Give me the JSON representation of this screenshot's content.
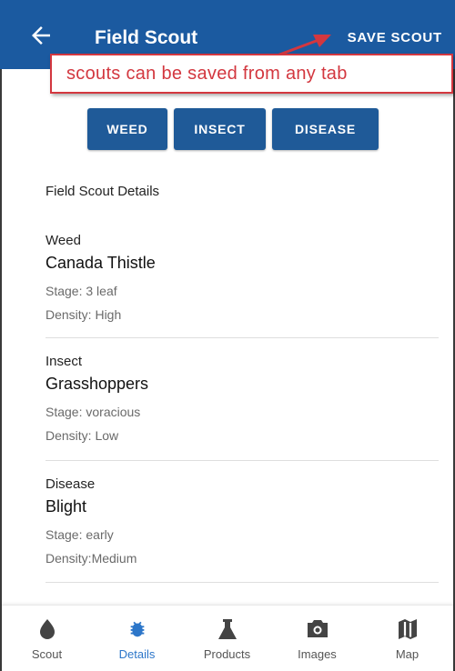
{
  "colors": {
    "appbar": "#1b5aa0",
    "tab": "#1f5a98",
    "annotation": "#d3373f",
    "active_nav": "#2c76c9"
  },
  "header": {
    "back_icon": "arrow-left-icon",
    "title": "Field Scout",
    "save_label": "SAVE SCOUT"
  },
  "annotation": {
    "text": "scouts can be saved from any tab"
  },
  "tabs": [
    {
      "label": "WEED"
    },
    {
      "label": "INSECT"
    },
    {
      "label": "DISEASE"
    }
  ],
  "details": {
    "title": "Field Scout Details",
    "entries": [
      {
        "category": "Weed",
        "name": "Canada Thistle",
        "stage": "Stage: 3 leaf",
        "density": "Density: High"
      },
      {
        "category": "Insect",
        "name": "Grasshoppers",
        "stage": "Stage: voracious",
        "density": "Density: Low"
      },
      {
        "category": "Disease",
        "name": "Blight",
        "stage": "Stage: early",
        "density": "Density:Medium"
      }
    ]
  },
  "bottom_nav": {
    "active": "Details",
    "items": [
      {
        "label": "Scout",
        "icon": "drop-icon"
      },
      {
        "label": "Details",
        "icon": "bug-icon"
      },
      {
        "label": "Products",
        "icon": "flask-icon"
      },
      {
        "label": "Images",
        "icon": "camera-icon"
      },
      {
        "label": "Map",
        "icon": "map-icon"
      }
    ]
  }
}
